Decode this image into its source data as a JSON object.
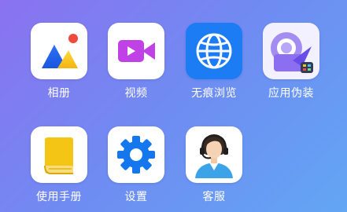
{
  "apps": [
    {
      "label": "相册",
      "icon": "photo-album-icon"
    },
    {
      "label": "视频",
      "icon": "video-camera-icon"
    },
    {
      "label": "无痕浏览",
      "icon": "globe-icon"
    },
    {
      "label": "应用伪装",
      "icon": "rocket-disguise-icon"
    },
    {
      "label": "使用手册",
      "icon": "manual-book-icon"
    },
    {
      "label": "设置",
      "icon": "gear-icon"
    },
    {
      "label": "客服",
      "icon": "customer-service-icon"
    }
  ],
  "colors": {
    "background_start": "#8a72f0",
    "background_end": "#62a6f4",
    "photo_accent": "#ee4b3e",
    "video": "#c041e6",
    "browser": "#1b7cf3",
    "manual": "#f5c516",
    "settings": "#1577ee"
  }
}
